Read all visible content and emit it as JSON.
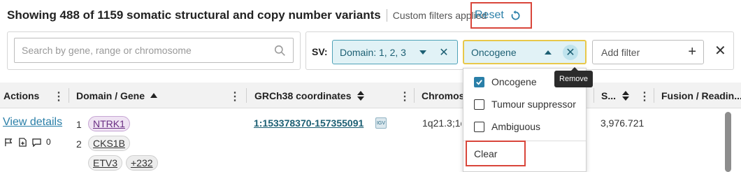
{
  "header": {
    "title": "Showing 488 of 1159 somatic structural and copy number variants",
    "custom_filters": "Custom filters applied",
    "reset_label": "Reset"
  },
  "search": {
    "placeholder": "Search by gene, range or chromosome"
  },
  "filters": {
    "sv_label": "SV:",
    "domain_chip": "Domain: 1, 2, 3",
    "oncogene_chip": "Oncogene",
    "add_filter_label": "Add filter"
  },
  "tooltip": {
    "remove": "Remove"
  },
  "dropdown": {
    "options": [
      {
        "label": "Oncogene",
        "checked": true
      },
      {
        "label": "Tumour suppressor",
        "checked": false
      },
      {
        "label": "Ambiguous",
        "checked": false
      }
    ],
    "clear_label": "Clear"
  },
  "table": {
    "columns": {
      "actions": "Actions",
      "domain_gene": "Domain / Gene",
      "coords": "GRCh38 coordinates",
      "chromosome": "Chromos",
      "s": "S...",
      "fusion": "Fusion / Readin..."
    },
    "row": {
      "view_details": "View details",
      "comment_count": "0",
      "domain_1": "1",
      "domain_2": "2",
      "gene_1": "NTRK1",
      "gene_2": "CKS1B",
      "gene_3": "ETV3",
      "more_genes": "+232",
      "coordinates": "1:153378370-157355091",
      "chromosome": "1q21.3;1q",
      "s_value": "3,976.721"
    }
  },
  "colors": {
    "accent": "#2a7fa8",
    "chip_bg": "#e1f2f6",
    "highlight_red": "#d9463b",
    "focus_yellow": "#e8c84a"
  }
}
